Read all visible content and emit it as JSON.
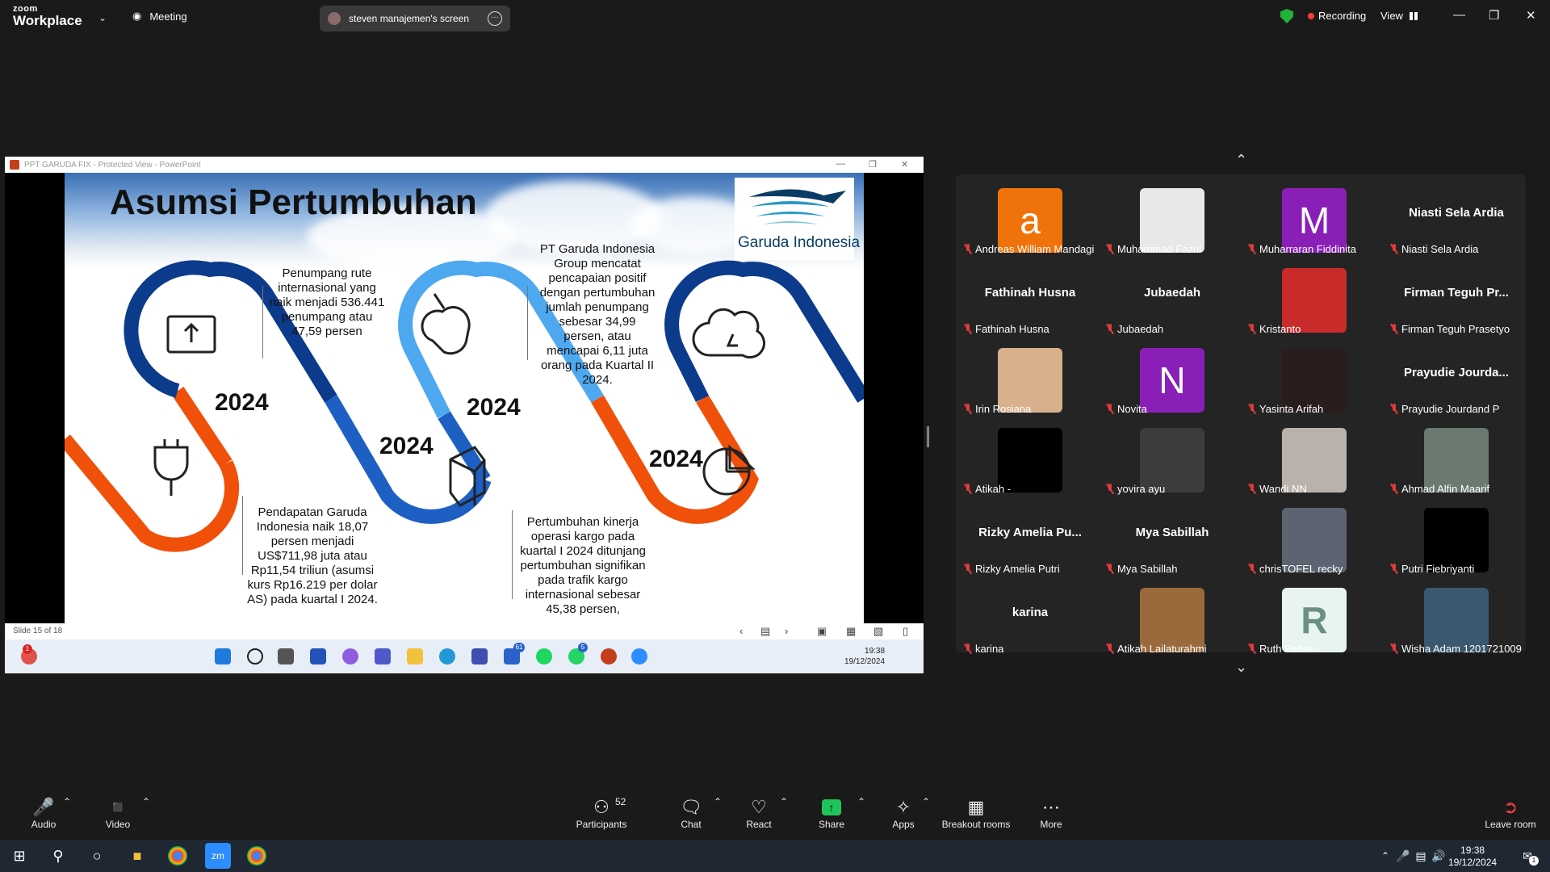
{
  "app": {
    "logo_line1": "zoom",
    "logo_line2": "Workplace"
  },
  "topbar": {
    "meeting_label": "Meeting",
    "share_pill_label": "steven manajemen's screen",
    "recording_label": "Recording",
    "view_label": "View"
  },
  "ppt": {
    "window_title": "PPT GARUDA FIX  -  Protected View  -  PowerPoint",
    "slide_counter": "Slide 15 of 18",
    "slide": {
      "title": "Asumsi Pertumbuhan",
      "logo_text": "Garuda Indonesia",
      "years": [
        "2024",
        "2024",
        "2024",
        "2024"
      ],
      "text1": "Penumpang rute internasional yang naik menjadi 536.441 penumpang atau 47,59 persen",
      "text2": "PT Garuda Indonesia Group mencatat pencapaian positif dengan pertumbuhan jumlah penumpang sebesar 34,99 persen, atau mencapai 6,11 juta orang pada Kuartal II 2024.",
      "text3": "Pendapatan Garuda Indonesia naik 18,07 persen menjadi US$711,98 juta atau Rp11,54 triliun (asumsi kurs Rp16.219 per dolar AS) pada kuartal I 2024.",
      "text4": "Pertumbuhan kinerja operasi kargo pada kuartal I 2024 ditunjang pertumbuhan signifikan pada trafik kargo internasional sebesar 45,38 persen,"
    },
    "inner_clock": {
      "time": "19:38",
      "date": "19/12/2024"
    },
    "badges": {
      "notif": "1",
      "teams": "61",
      "whatsapp": "5"
    }
  },
  "gallery": [
    {
      "name": "Andreas William Mandagi",
      "avatar": "a",
      "color": "#f0720a"
    },
    {
      "name": "Muhammad Fazril",
      "avatar": "",
      "color": "#e8e8e8"
    },
    {
      "name": "Muharraran Fiddinita",
      "avatar": "M",
      "color": "#8a1fb8"
    },
    {
      "name": "Niasti Sela Ardia",
      "display": "Niasti Sela Ardia"
    },
    {
      "name": "Fathinah Husna",
      "display": "Fathinah Husna"
    },
    {
      "name": "Jubaedah",
      "display": "Jubaedah"
    },
    {
      "name": "Kristanto",
      "avatar": "",
      "color": "#c92b2b"
    },
    {
      "name": "Firman Teguh Prasetyo",
      "display": "Firman Teguh Pr..."
    },
    {
      "name": "Irin Rosiana",
      "avatar": "",
      "color": "#d9b08c"
    },
    {
      "name": "Novita",
      "avatar": "N",
      "color": "#8a1fb8"
    },
    {
      "name": "Yasinta Arifah",
      "avatar": "",
      "color": "#2a1d1d"
    },
    {
      "name": "Prayudie Jourdand P",
      "display": "Prayudie Jourda..."
    },
    {
      "name": "Atikah -",
      "avatar": "",
      "color": "#000000"
    },
    {
      "name": "yovira ayu",
      "avatar": "",
      "color": "#3c3c3c"
    },
    {
      "name": "Wandi NN",
      "avatar": "",
      "color": "#b9b2aa"
    },
    {
      "name": "Ahmad Alfin Maarif",
      "avatar": "",
      "color": "#6a7a70"
    },
    {
      "name": "Rizky Amelia Putri",
      "display": "Rizky Amelia Pu..."
    },
    {
      "name": "Mya Sabillah",
      "display": "Mya Sabillah"
    },
    {
      "name": "chrisTOFEL recky",
      "avatar": "",
      "color": "#5b6470"
    },
    {
      "name": "Putri Fiebriyanti",
      "avatar": "",
      "color": "#000000"
    },
    {
      "name": "karina",
      "display": "karina"
    },
    {
      "name": "Atikah Lailaturahmi",
      "avatar": "",
      "color": "#9b6a3c"
    },
    {
      "name": "Ruth Pabaru",
      "avatar": "R",
      "color": "#e7f5ee"
    },
    {
      "name": "Wisha Adam 1201721009",
      "avatar": "",
      "color": "#3a5870"
    }
  ],
  "toolbar": {
    "audio": "Audio",
    "video": "Video",
    "participants": "Participants",
    "participants_count": "52",
    "chat": "Chat",
    "react": "React",
    "share": "Share",
    "apps": "Apps",
    "breakout": "Breakout rooms",
    "more": "More",
    "leave": "Leave room"
  },
  "wtaskbar": {
    "time": "19:38",
    "date": "19/12/2024",
    "notif": "1"
  },
  "colors": {
    "slide_orange": "#f0500a",
    "slide_navy": "#0d3b8c",
    "slide_blue": "#2f7be0",
    "slide_light": "#4ea8f0"
  }
}
